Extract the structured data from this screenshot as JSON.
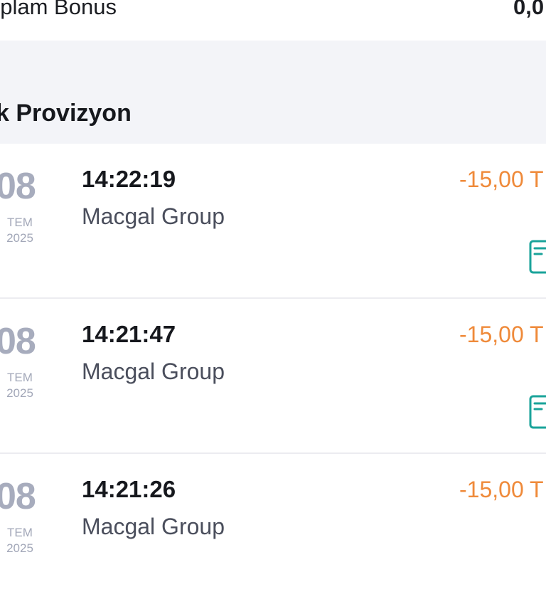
{
  "summary": {
    "total_bonus_label": "oplam Bonus",
    "total_bonus_value": "0,0"
  },
  "section": {
    "title": "k Provizyon"
  },
  "transactions": [
    {
      "day": "08",
      "month": "TEM",
      "year": "2025",
      "time": "14:22:19",
      "merchant": "Macgal Group",
      "amount": "-15,00 T",
      "icon": "receipt-icon"
    },
    {
      "day": "08",
      "month": "TEM",
      "year": "2025",
      "time": "14:21:47",
      "merchant": "Macgal Group",
      "amount": "-15,00 T",
      "icon": "receipt-icon"
    },
    {
      "day": "08",
      "month": "TEM",
      "year": "2025",
      "time": "14:21:26",
      "merchant": "Macgal Group",
      "amount": "-15,00 T",
      "icon": "receipt-icon"
    }
  ],
  "colors": {
    "amount_negative": "#ef8a3a",
    "receipt_icon": "#1aa39a",
    "date_gray": "#a7acbd",
    "section_background": "#f3f4f8"
  }
}
